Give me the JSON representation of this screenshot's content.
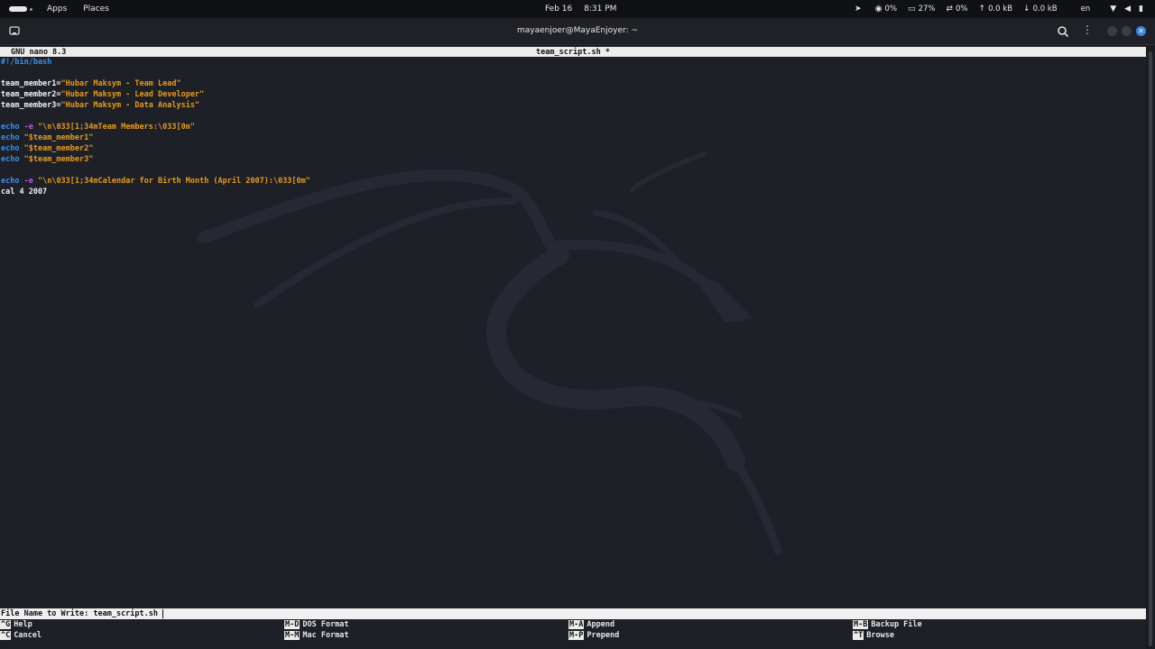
{
  "top_bar": {
    "menus": [
      "Apps",
      "Places"
    ],
    "date": "Feb 16",
    "time": "8:31 PM",
    "tray": {
      "cpu": "0%",
      "memory": "27%",
      "swap": "0%",
      "upload": "0.0 kB",
      "download": "0.0 kB",
      "language": "en"
    }
  },
  "window": {
    "title": "mayaenjoer@MayaEnjoyer: ~"
  },
  "nano": {
    "version": "GNU nano 8.3",
    "filename": "team_script.sh *",
    "lines": [
      [
        {
          "t": "#!/bin/bash",
          "c": "blue"
        }
      ],
      [],
      [
        {
          "t": "team_member1=",
          "c": "white"
        },
        {
          "t": "\"Hubar Maksym - Team Lead\"",
          "c": "orange"
        }
      ],
      [
        {
          "t": "team_member2=",
          "c": "white"
        },
        {
          "t": "\"Hubar Maksym - Lead Developer\"",
          "c": "orange"
        }
      ],
      [
        {
          "t": "team_member3=",
          "c": "white"
        },
        {
          "t": "\"Hubar Maksym - Data Analysis\"",
          "c": "orange"
        }
      ],
      [],
      [
        {
          "t": "echo",
          "c": "blue"
        },
        {
          "t": " -e ",
          "c": "purple"
        },
        {
          "t": "\"\\n\\033[1;34mTeam Members:\\033[0m\"",
          "c": "orange"
        }
      ],
      [
        {
          "t": "echo",
          "c": "blue"
        },
        {
          "t": " \"$team_member1\"",
          "c": "orange"
        }
      ],
      [
        {
          "t": "echo",
          "c": "blue"
        },
        {
          "t": " \"$team_member2\"",
          "c": "orange"
        }
      ],
      [
        {
          "t": "echo",
          "c": "blue"
        },
        {
          "t": " \"$team_member3\"",
          "c": "orange"
        }
      ],
      [],
      [
        {
          "t": "echo",
          "c": "blue"
        },
        {
          "t": " -e ",
          "c": "purple"
        },
        {
          "t": "\"\\n\\033[1;34mCalendar for Birth Month (April 2007):\\033[0m\"",
          "c": "orange"
        }
      ],
      [
        {
          "t": "cal 4 2007",
          "c": "white"
        }
      ]
    ],
    "prompt_label": "File Name to Write: ",
    "prompt_value": "team_script.sh",
    "shortcuts": [
      {
        "key": "^G",
        "label": "Help"
      },
      {
        "key": "^C",
        "label": "Cancel"
      },
      {
        "key": "M-D",
        "label": "DOS Format"
      },
      {
        "key": "M-M",
        "label": "Mac Format"
      },
      {
        "key": "M-A",
        "label": "Append"
      },
      {
        "key": "M-P",
        "label": "Prepend"
      },
      {
        "key": "M-B",
        "label": "Backup File"
      },
      {
        "key": "^T",
        "label": "Browse"
      }
    ]
  },
  "colors": {
    "blue": "#3a8fe8",
    "orange": "#e69a1c",
    "purple": "#b65cdc",
    "white": "#f0f0f0"
  }
}
